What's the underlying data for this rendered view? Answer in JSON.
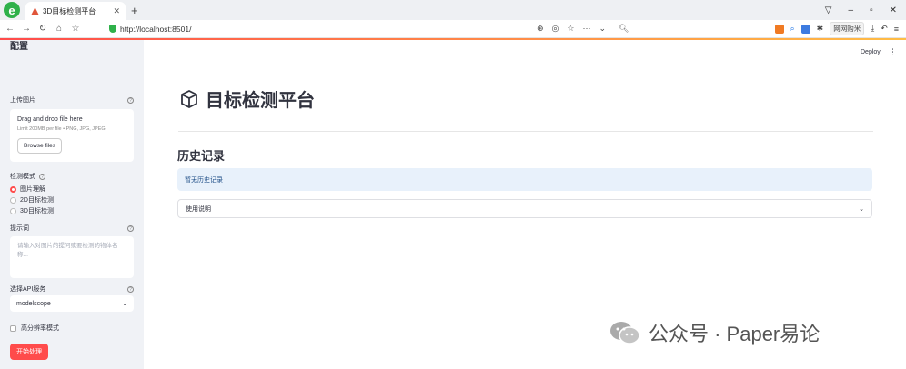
{
  "browser": {
    "tab_title": "3D目标检测平台",
    "url": "http://localhost:8501/",
    "ext_label": "网网购米"
  },
  "app": {
    "deploy_label": "Deploy",
    "page_title": "目标检测平台",
    "history_title": "历史记录",
    "empty_history": "暂无历史记录",
    "expander_label": "使用说明"
  },
  "sidebar": {
    "title": "配置",
    "upload_label": "上传图片",
    "drag_text": "Drag and drop file here",
    "limit_text": "Limit 200MB per file • PNG, JPG, JPEG",
    "browse_label": "Browse files",
    "mode_label": "检测模式",
    "modes": [
      "图片理解",
      "2D目标检测",
      "3D目标检测"
    ],
    "selected_mode_index": 0,
    "prompt_label": "提示词",
    "prompt_placeholder": "请输入对图片的提问或要检测的物体名称...",
    "api_label": "选择API服务",
    "api_value": "modelscope",
    "hires_label": "高分辨率模式",
    "start_label": "开始处理"
  },
  "watermark": {
    "text": "公众号 · Paper易论"
  },
  "colors": {
    "accent": "#ff4b4b",
    "info_bg": "#e8f1fb",
    "sidebar_bg": "#f0f2f6"
  }
}
